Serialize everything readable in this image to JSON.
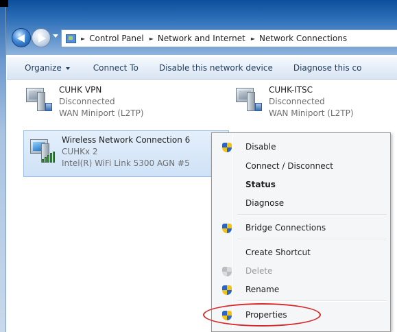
{
  "address_bar": {
    "crumbs": [
      "Control Panel",
      "Network and Internet",
      "Network Connections"
    ],
    "separator": "►"
  },
  "toolbar": {
    "organize": "Organize",
    "connect_to": "Connect To",
    "disable_device": "Disable this network device",
    "diagnose": "Diagnose this co"
  },
  "connections": [
    {
      "name": "CUHK VPN",
      "status": "Disconnected",
      "device": "WAN Miniport (L2TP)"
    },
    {
      "name": "CUHK-ITSC",
      "status": "Disconnected",
      "device": "WAN Miniport (L2TP)"
    },
    {
      "name": "Wireless Network Connection 6",
      "status": "CUHKx 2",
      "device": "Intel(R) WiFi Link 5300 AGN #5"
    }
  ],
  "context_menu": {
    "items": [
      {
        "label": "Disable",
        "icon": "uac-shield-icon"
      },
      {
        "label": "Connect / Disconnect"
      },
      {
        "label": "Status",
        "bold": true
      },
      {
        "label": "Diagnose"
      },
      {
        "label": "Bridge Connections",
        "icon": "uac-shield-icon"
      },
      {
        "label": "Create Shortcut"
      },
      {
        "label": "Delete",
        "icon": "uac-shield-icon",
        "disabled": true
      },
      {
        "label": "Rename",
        "icon": "uac-shield-icon"
      },
      {
        "label": "Properties",
        "icon": "uac-shield-icon",
        "highlighted": true
      }
    ]
  },
  "colors": {
    "selection": "#cfe2f7",
    "annotation_ring": "#d8282b",
    "title_bar": "#2d6fb8"
  }
}
